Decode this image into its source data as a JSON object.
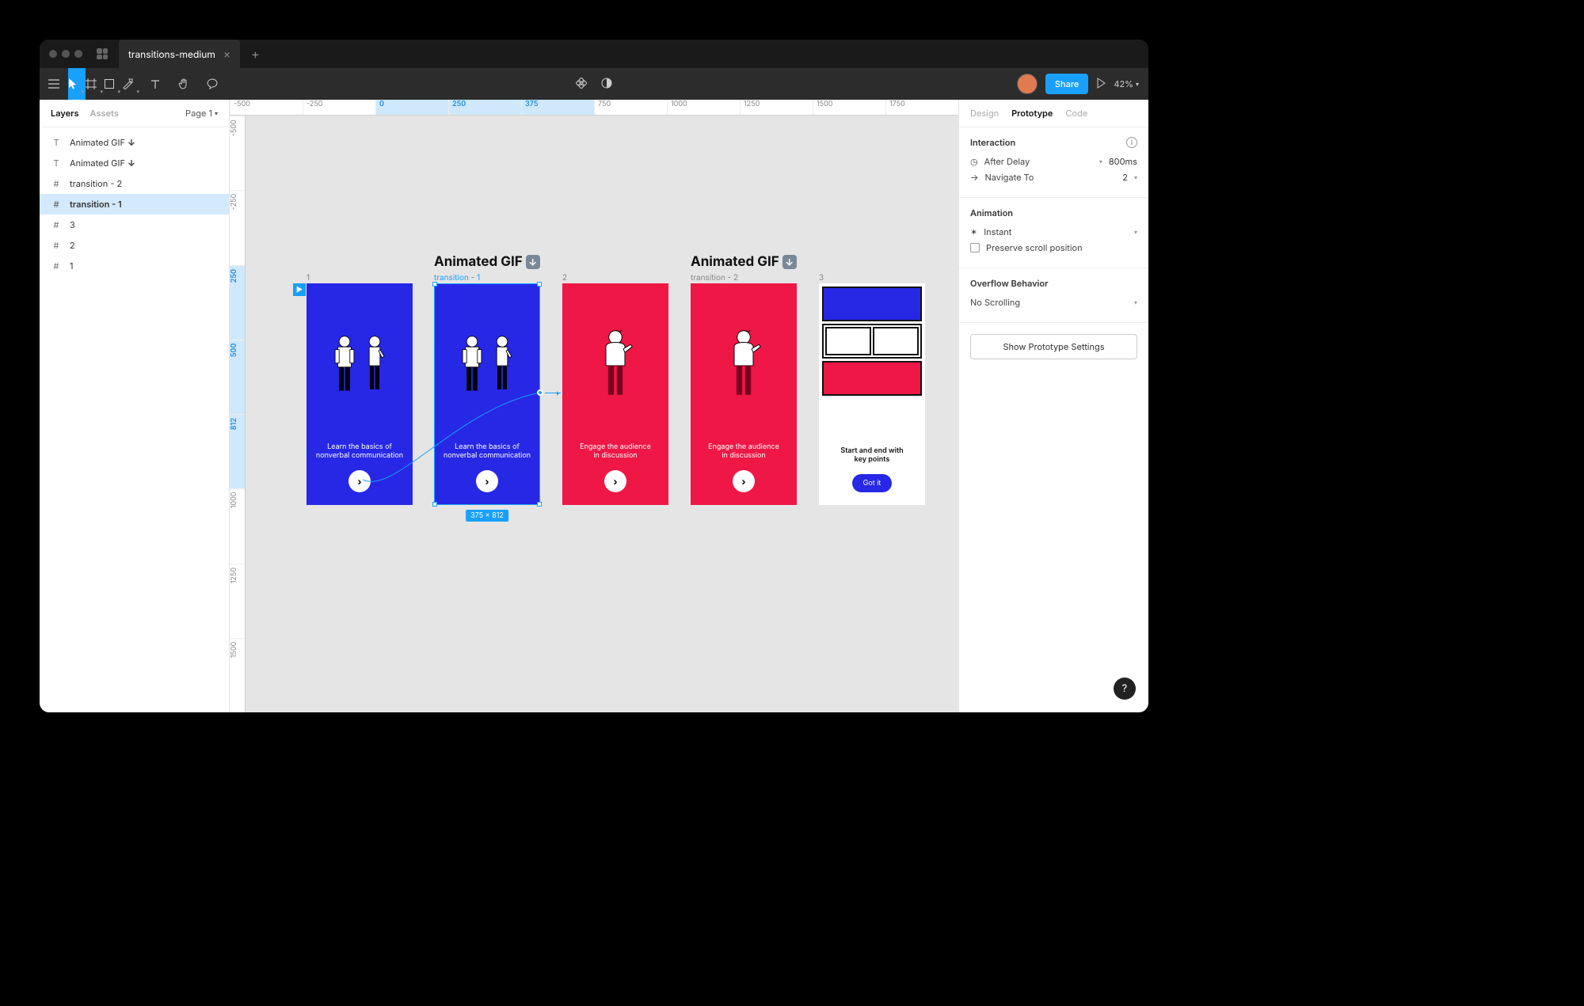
{
  "tab": {
    "title": "transitions-medium"
  },
  "toolbar": {
    "share": "Share",
    "zoom": "42%"
  },
  "leftPanel": {
    "tabs": {
      "layers": "Layers",
      "assets": "Assets"
    },
    "page": "Page 1",
    "layers": [
      {
        "icon": "T",
        "label": "Animated GIF ",
        "suffix": "↓"
      },
      {
        "icon": "T",
        "label": "Animated GIF ",
        "suffix": "↓"
      },
      {
        "icon": "#",
        "label": "transition - 2"
      },
      {
        "icon": "#",
        "label": "transition - 1",
        "selected": true
      },
      {
        "icon": "#",
        "label": "3"
      },
      {
        "icon": "#",
        "label": "2"
      },
      {
        "icon": "#",
        "label": "1"
      }
    ]
  },
  "canvas": {
    "rulerH": [
      "-500",
      "-250",
      "0",
      "250",
      "375",
      "750",
      "1000",
      "1250",
      "1500",
      "1750"
    ],
    "rulerV": [
      "-500",
      "-250",
      "250",
      "500",
      "812",
      "1000",
      "1250",
      "1500"
    ],
    "heading1": "Animated GIF",
    "heading2": "Animated GIF",
    "frames": {
      "f1": {
        "label": "1",
        "text1": "Learn the basics of",
        "text2": "nonverbal communication"
      },
      "f2": {
        "label": "transition - 1",
        "text1": "Learn the basics of",
        "text2": "nonverbal communication"
      },
      "f3": {
        "label": "2",
        "text1": "Engage the audience",
        "text2": "in discussion"
      },
      "f4": {
        "label": "transition - 2",
        "text1": "Engage the audience",
        "text2": "in discussion"
      },
      "f5": {
        "label": "3",
        "text1": "Start and end with",
        "text2": "key points",
        "button": "Got it"
      }
    },
    "selBadge": "375 × 812"
  },
  "rightPanel": {
    "tabs": {
      "design": "Design",
      "prototype": "Prototype",
      "code": "Code"
    },
    "interaction": {
      "title": "Interaction",
      "trigger": "After Delay",
      "delay": "800ms",
      "action": "Navigate To",
      "target": "2"
    },
    "animation": {
      "title": "Animation",
      "type": "Instant",
      "preserve": "Preserve scroll position"
    },
    "overflow": {
      "title": "Overflow Behavior",
      "value": "No Scrolling"
    },
    "button": "Show Prototype Settings"
  }
}
